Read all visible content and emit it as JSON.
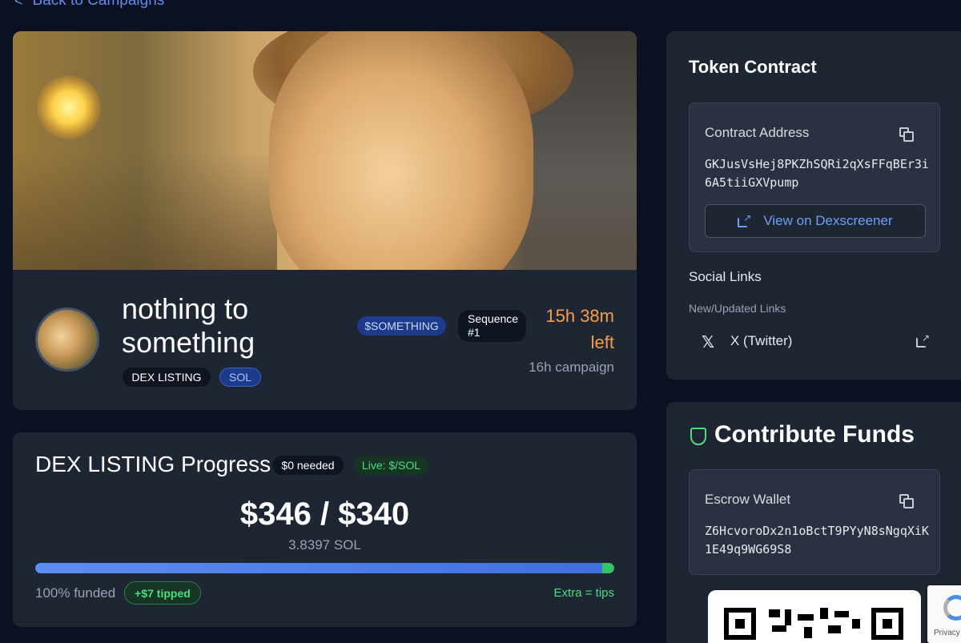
{
  "nav": {
    "back_label": "Back to Campaigns"
  },
  "campaign": {
    "title": "nothing to something",
    "tags": [
      "DEX LISTING",
      "SOL"
    ],
    "ticker": "$SOMETHING",
    "sequence": "Sequence #1",
    "time_left": "15h 38m left",
    "duration": "16h campaign"
  },
  "progress": {
    "title": "DEX LISTING Progress",
    "needed": "$0 needed",
    "live": "Live: $/SOL",
    "amount": "$346 / $340",
    "sol_amount": "3.8397 SOL",
    "percent_funded": 100,
    "funded_label": "100% funded",
    "tipped_label": "+$7 tipped",
    "extra_label": "Extra = tips"
  },
  "token": {
    "title": "Token Contract",
    "address_label": "Contract Address",
    "address": "GKJusVsHej8PKZhSQRi2qXsFFqBEr3i6A5tiiGXVpump",
    "dex_button": "View on Dexscreener",
    "social_title": "Social Links",
    "social_subtitle": "New/Updated Links",
    "social_links": [
      {
        "label": "X (Twitter)",
        "icon": "x-logo-icon"
      }
    ]
  },
  "contribute": {
    "title": "Contribute Funds",
    "escrow_label": "Escrow Wallet",
    "escrow_address": "Z6HcvoroDx2n1oBctT9PYyN8sNgqXiK1E49q9WG69S8"
  },
  "recaptcha": {
    "text": "Privacy"
  },
  "colors": {
    "accent": "#5b8def",
    "warning": "#f59e4b",
    "success": "#4ade80",
    "card": "#1e2533",
    "background": "#0b1120"
  }
}
